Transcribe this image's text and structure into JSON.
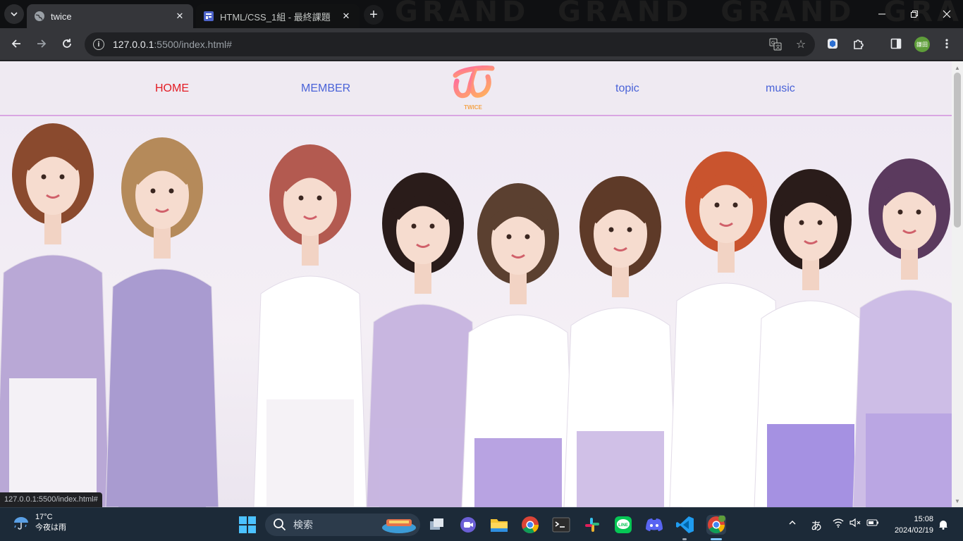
{
  "browser": {
    "tabs": [
      {
        "title": "twice",
        "active": true
      },
      {
        "title": "HTML/CSS_1組 - 最終課題",
        "active": false
      }
    ],
    "url_host": "127.0.0.1",
    "url_rest": ":5500/index.html#",
    "profile_label": "鎌田",
    "status_url": "127.0.0.1:5500/index.html#"
  },
  "site": {
    "nav": [
      {
        "label": "HOME",
        "current": true
      },
      {
        "label": "MEMBER",
        "current": false
      },
      {
        "label": "topic",
        "current": false
      },
      {
        "label": "music",
        "current": false
      }
    ],
    "logo_text": "TWICE",
    "accent_color": "#e31b23",
    "link_color": "#4a63d8",
    "divider_color": "#d9a6e3",
    "hero_image": "group photo of nine members in lavender and white outfits"
  },
  "taskbar": {
    "weather_temp": "17°C",
    "weather_desc": "今夜は雨",
    "search_placeholder": "検索",
    "ime": "あ",
    "time": "15:08",
    "date": "2024/02/19",
    "apps": [
      "task-view",
      "video-call",
      "file-explorer",
      "chrome",
      "terminal",
      "slack",
      "line",
      "discord",
      "vscode",
      "chrome-active"
    ]
  }
}
